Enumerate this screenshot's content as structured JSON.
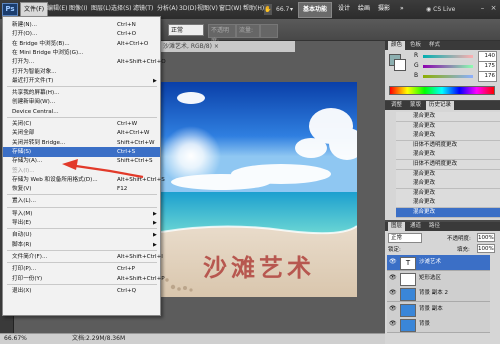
{
  "menubar": {
    "logo": "Ps",
    "items": [
      "文件(F)",
      "编辑(E)",
      "图像(I)",
      "图层(L)",
      "选择(S)",
      "滤镜(T)",
      "分析(A)",
      "3D(D)",
      "视图(V)",
      "窗口(W)",
      "帮助(H)"
    ],
    "zoom": "66.7",
    "workspaces": [
      "基本功能",
      "设计",
      "绘画",
      "摄影"
    ],
    "more": "»",
    "cs_live": "CS Live"
  },
  "options": {
    "mode": "正常",
    "opacity": "不透明度:",
    "flow": "流量:"
  },
  "document": {
    "tab": "沙滩艺术, RGB/8) ×",
    "art_text": "沙滩艺术",
    "zoom_status": "66.67%",
    "doc_status": "文档:2.29M/8.36M"
  },
  "file_menu": [
    {
      "label": "新建(N)...",
      "shortcut": "Ctrl+N"
    },
    {
      "label": "打开(O)...",
      "shortcut": "Ctrl+O"
    },
    {
      "label": "在 Bridge 中浏览(B)...",
      "shortcut": "Alt+Ctrl+O"
    },
    {
      "label": "在 Mini Bridge 中浏览(G)..."
    },
    {
      "label": "打开为...",
      "shortcut": "Alt+Shift+Ctrl+O"
    },
    {
      "label": "打开为智能对象..."
    },
    {
      "label": "最近打开文件(T)",
      "submenu": true
    },
    {
      "sep": true
    },
    {
      "label": "共享我的屏幕(H)..."
    },
    {
      "label": "创建新审阅(W)..."
    },
    {
      "label": "Device Central..."
    },
    {
      "sep": true
    },
    {
      "label": "关闭(C)",
      "shortcut": "Ctrl+W"
    },
    {
      "label": "关闭全部",
      "shortcut": "Alt+Ctrl+W"
    },
    {
      "label": "关闭并转到 Bridge...",
      "shortcut": "Shift+Ctrl+W"
    },
    {
      "label": "存储(S)",
      "shortcut": "Ctrl+S",
      "highlight": true
    },
    {
      "label": "存储为(A)...",
      "shortcut": "Shift+Ctrl+S"
    },
    {
      "label": "签入(I)...",
      "disabled": true
    },
    {
      "label": "存储为 Web 和设备所用格式(D)...",
      "shortcut": "Alt+Shift+Ctrl+S"
    },
    {
      "label": "恢复(V)",
      "shortcut": "F12"
    },
    {
      "sep": true
    },
    {
      "label": "置入(L)..."
    },
    {
      "sep": true
    },
    {
      "label": "导入(M)",
      "submenu": true
    },
    {
      "label": "导出(E)",
      "submenu": true
    },
    {
      "sep": true
    },
    {
      "label": "自动(U)",
      "submenu": true
    },
    {
      "label": "脚本(R)",
      "submenu": true
    },
    {
      "sep": true
    },
    {
      "label": "文件简介(F)...",
      "shortcut": "Alt+Shift+Ctrl+I"
    },
    {
      "sep": true
    },
    {
      "label": "打印(P)...",
      "shortcut": "Ctrl+P"
    },
    {
      "label": "打印一份(Y)",
      "shortcut": "Alt+Shift+Ctrl+P"
    },
    {
      "sep": true
    },
    {
      "label": "退出(X)",
      "shortcut": "Ctrl+Q"
    }
  ],
  "color_panel": {
    "tabs": [
      "颜色",
      "色板",
      "样式"
    ],
    "channels": [
      {
        "label": "R",
        "value": "140"
      },
      {
        "label": "G",
        "value": "175"
      },
      {
        "label": "B",
        "value": "176"
      }
    ]
  },
  "history_panel": {
    "tabs": [
      "调整",
      "蒙版",
      "历史记录"
    ],
    "items": [
      "混合更改",
      "混合更改",
      "混合更改",
      "旧体不透明度更改",
      "混合更改",
      "旧体不透明度更改",
      "混合更改",
      "混合更改",
      "混合更改",
      "混合更改",
      "混合更改"
    ],
    "selected_index": 10
  },
  "layers_panel": {
    "tabs": [
      "图层",
      "通道",
      "路径"
    ],
    "blend_mode": "正常",
    "opacity_label": "不透明度:",
    "opacity_value": "100%",
    "lock_label": "锁定:",
    "fill_label": "填充:",
    "fill_value": "100%",
    "layers": [
      "沙滩艺术",
      "矩形选区",
      "背景 副本 2",
      "背景 副本",
      "背景"
    ],
    "selected_index": 0
  },
  "colors": {
    "accent": "#3b6fc6",
    "annotation_arrow": "#e23a2a",
    "art_text": "#b7574f"
  }
}
